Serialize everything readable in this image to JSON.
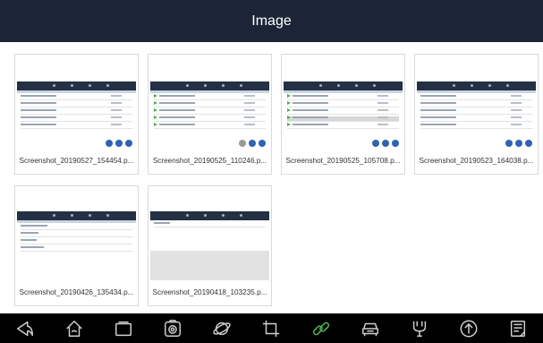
{
  "header": {
    "title": "Image"
  },
  "gallery": {
    "items": [
      {
        "caption": "Screenshot_20190527_154454.p..."
      },
      {
        "caption": "Screenshot_20190525_110246.p..."
      },
      {
        "caption": "Screenshot_20190525_105708.p..."
      },
      {
        "caption": "Screenshot_20190523_164038.p..."
      },
      {
        "caption": "Screenshot_20190426_135434.p..."
      },
      {
        "caption": "Screenshot_20190418_103235.p..."
      }
    ]
  },
  "navbar": {
    "icons": [
      "back-icon",
      "home-icon",
      "recent-apps-icon",
      "camera-icon",
      "browser-icon",
      "crop-icon",
      "link-icon",
      "car-icon",
      "vci-icon",
      "upload-icon",
      "document-icon"
    ],
    "colors": {
      "background": "#000000",
      "icon": "#cfcfcf",
      "active": "#4caf50"
    }
  },
  "colors": {
    "header_bg": "#1b2537"
  }
}
